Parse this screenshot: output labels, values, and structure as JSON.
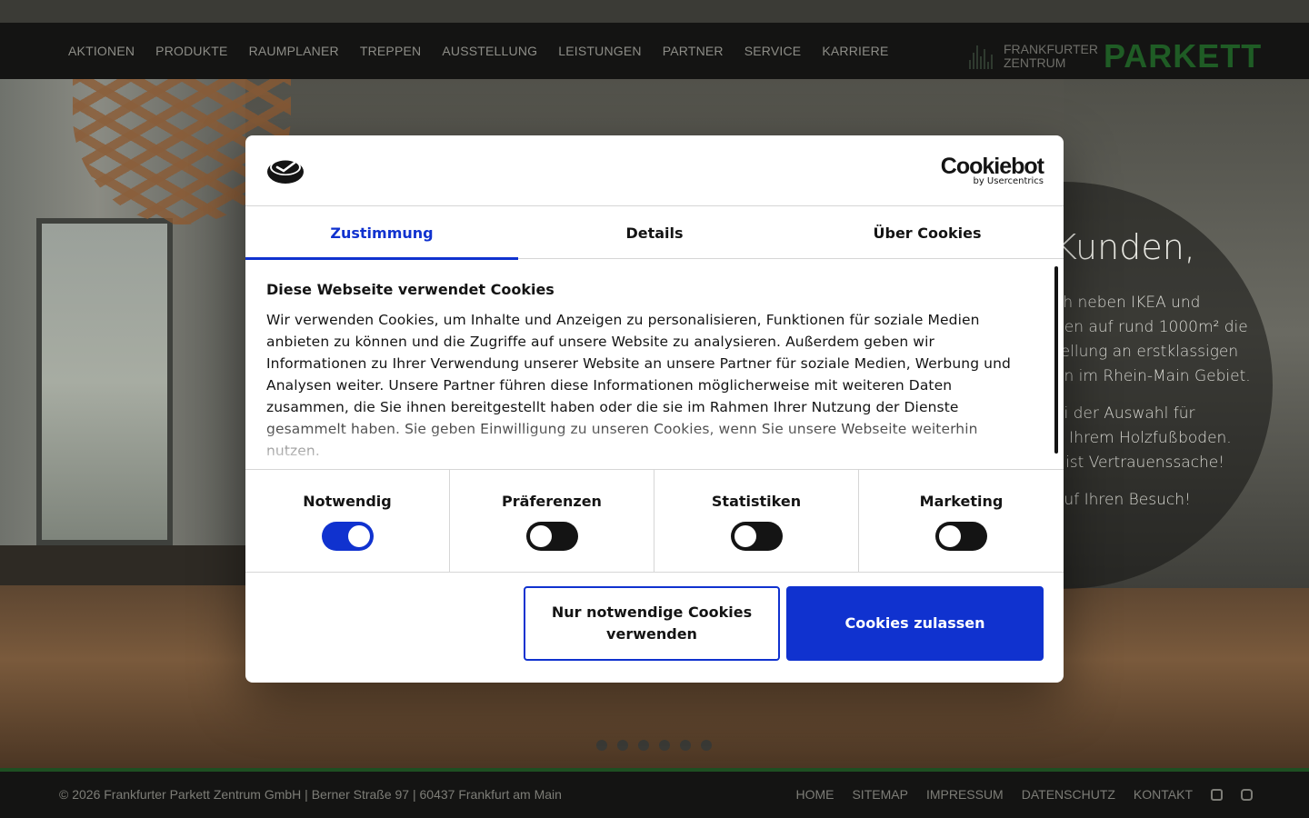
{
  "nav": {
    "items": [
      "AKTIONEN",
      "PRODUKTE",
      "RAUMPLANER",
      "TREPPEN",
      "AUSSTELLUNG",
      "LEISTUNGEN",
      "PARTNER",
      "SERVICE",
      "KARRIERE"
    ],
    "logo_small_line1": "FRANKFURTER",
    "logo_small_line2": "ZENTRUM",
    "logo_big": "PARKETT"
  },
  "hero": {
    "greeting": "Kunden,",
    "para1": [
      "ch neben IKEA und",
      "nen auf rund 1000m² die",
      "tellung an erstklassigen",
      "en im Rhein-Main Gebiet."
    ],
    "para2": [
      "ei der Auswahl für",
      "n Ihrem Holzfußboden.",
      "t ist Vertrauenssache!"
    ],
    "para3": "auf Ihren Besuch!",
    "slider_dots": 6
  },
  "dialog": {
    "brand": "Cookiebot",
    "brand_by": "by Usercentrics",
    "tabs": [
      "Zustimmung",
      "Details",
      "Über Cookies"
    ],
    "active_tab": "Zustimmung",
    "heading": "Diese Webseite verwendet Cookies",
    "text": "Wir verwenden Cookies, um Inhalte und Anzeigen zu personalisieren, Funktionen für soziale Medien anbieten zu können und die Zugriffe auf unsere Website zu analysieren. Außerdem geben wir Informationen zu Ihrer Verwendung unserer Website an unsere Partner für soziale Medien, Werbung und Analysen weiter. Unsere Partner führen diese Informationen möglicherweise mit weiteren Daten zusammen, die Sie ihnen bereitgestellt haben oder die sie im Rahmen Ihrer Nutzung der Dienste gesammelt haben. Sie geben Einwilligung zu unseren Cookies, wenn Sie unsere Webseite weiterhin nutzen.",
    "toggles": [
      {
        "label": "Notwendig",
        "on": true
      },
      {
        "label": "Präferenzen",
        "on": false
      },
      {
        "label": "Statistiken",
        "on": false
      },
      {
        "label": "Marketing",
        "on": false
      }
    ],
    "btn_necessary": "Nur notwendige Cookies verwenden",
    "btn_allow": "Cookies zulassen",
    "accent_color": "#1032cf"
  },
  "footer": {
    "copyright": "© 2026 Frankfurter Parkett Zentrum GmbH | Berner Straße 97 | 60437 Frankfurt am Main",
    "links": [
      "HOME",
      "SITEMAP",
      "IMPRESSUM",
      "DATENSCHUTZ",
      "KONTAKT"
    ],
    "social_icons": [
      "facebook-icon",
      "instagram-icon"
    ]
  }
}
